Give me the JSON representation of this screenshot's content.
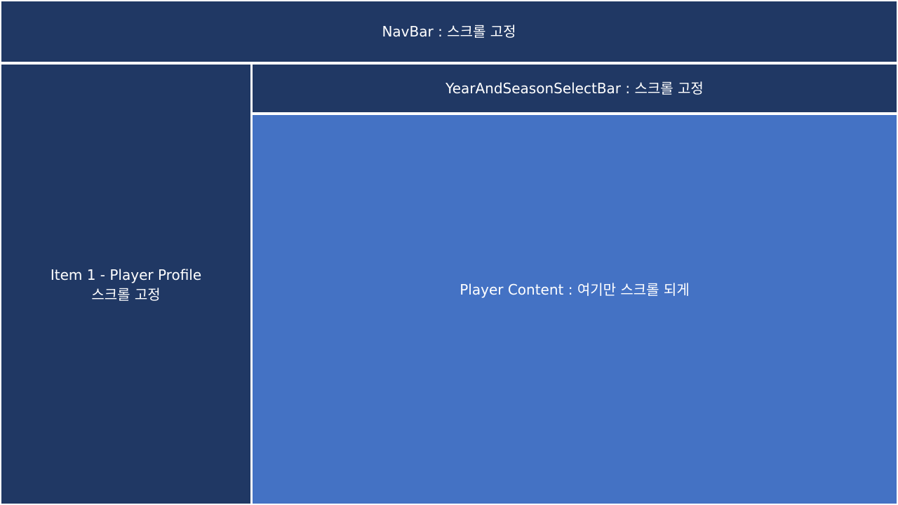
{
  "navbar": {
    "label": "NavBar : 스크롤 고정"
  },
  "sidebar": {
    "line1": "Item 1 - Player Profile",
    "line2": "스크롤 고정"
  },
  "select_bar": {
    "label": "YearAndSeasonSelectBar : 스크롤 고정"
  },
  "content": {
    "label": "Player Content : 여기만 스크롤 되게"
  },
  "colors": {
    "dark_navy": "#203864",
    "medium_blue": "#4472c4",
    "divider": "#ffffff"
  }
}
